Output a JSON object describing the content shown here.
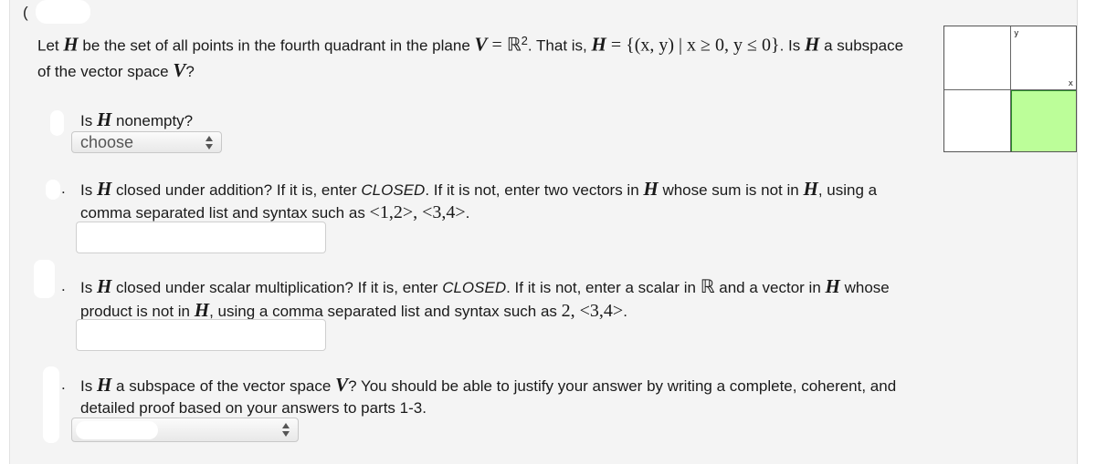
{
  "question": {
    "number_prefix": "(",
    "intro": {
      "t1": "Let ",
      "H": "H",
      "t2": " be the set of all points in the fourth quadrant in the plane ",
      "V": "V",
      "eq": " = ",
      "R": "ℝ",
      "sup": "2",
      "t3": ". That is, ",
      "set": " = {(x, y) | x ≥ 0, y ≤ 0}",
      "t4": ". Is ",
      "t5": " a subspace of the vector space ",
      "t6": "?"
    },
    "graph": {
      "x_label": "x",
      "y_label": "y",
      "highlighted_quadrant": "IV",
      "fill_color": "#bcfe99",
      "edge_color": "#2a8a2a"
    }
  },
  "parts": [
    {
      "t1": "Is ",
      "H": "H",
      "t2": " nonempty?",
      "select_value": "choose"
    },
    {
      "t1": "Is ",
      "H": "H",
      "t2": " closed under addition? If it is, enter ",
      "closed": "CLOSED",
      "t3": ". If it is not, enter two vectors in ",
      "t4": " whose sum is not in ",
      "t5": ", using a comma separated list and syntax such as ",
      "example": "<1,2>,  <3,4>",
      "t6": ".",
      "input_value": ""
    },
    {
      "t1": "Is ",
      "H": "H",
      "t2": " closed under scalar multiplication? If it is, enter ",
      "closed": "CLOSED",
      "t3": ". If it is not, enter a scalar in ",
      "R": "ℝ",
      "t4": " and a vector in ",
      "t5": " whose product is not in ",
      "t6": ", using a comma separated list and syntax such as ",
      "example": "2,  <3,4>",
      "t7": ".",
      "input_value": ""
    },
    {
      "t1": "Is ",
      "H": "H",
      "t2": " a subspace of the vector space ",
      "V": "V",
      "t3": "? You should be able to justify your answer by writing a complete, coherent, and detailed proof based on your answers to parts 1-3.",
      "select_value": ""
    }
  ],
  "part_marker": "."
}
